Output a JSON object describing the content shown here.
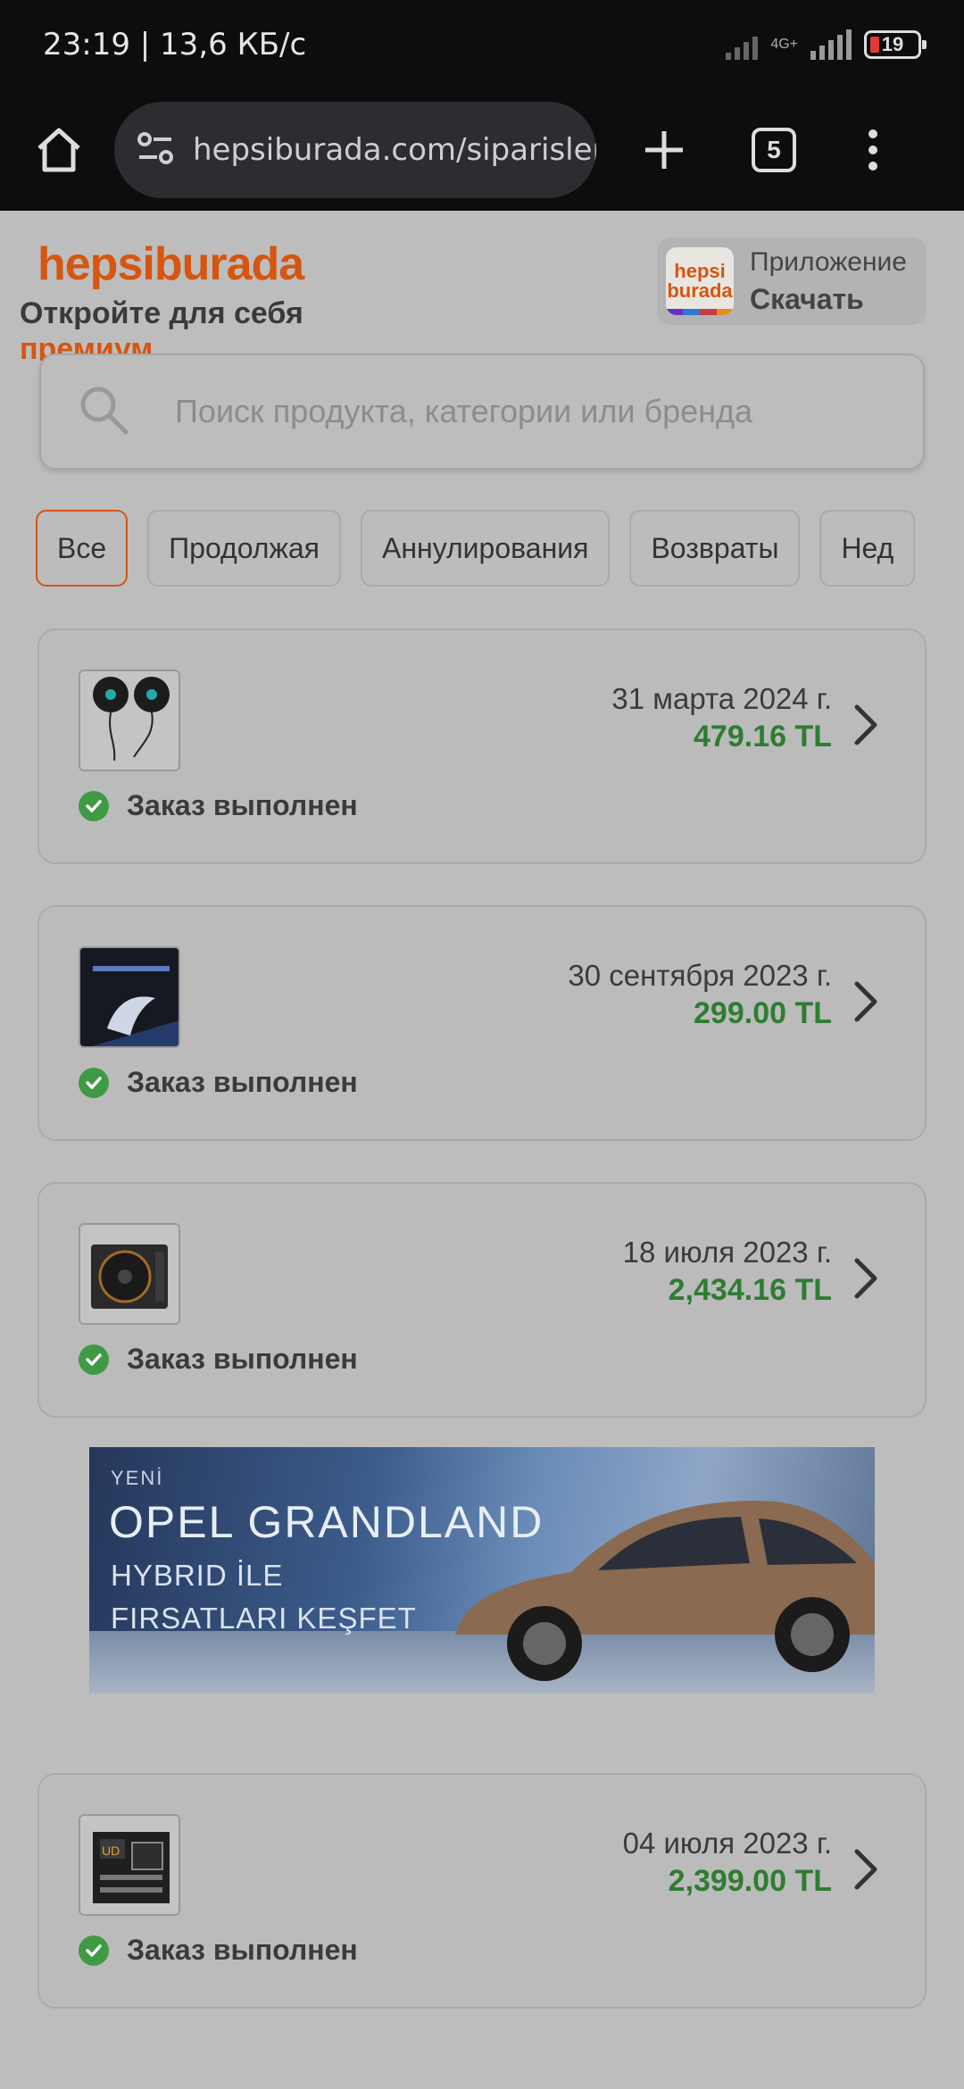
{
  "status_bar": {
    "time_speed": "23:19 | 13,6 КБ/с",
    "network": "4G+",
    "battery": "19"
  },
  "browser": {
    "url": "hepsiburada.com/siparisler",
    "tab_count": "5"
  },
  "header": {
    "brand": "hepsiburada",
    "tagline": "Откройте для себя",
    "tagline_highlight": "премиум",
    "app_icon_line1": "hepsi",
    "app_icon_line2": "burada",
    "app_title": "Приложение",
    "app_cta": "Скачать"
  },
  "search": {
    "placeholder": "Поиск продукта, категории или бренда"
  },
  "filters": [
    {
      "label": "Все",
      "active": true
    },
    {
      "label": "Продолжая",
      "active": false
    },
    {
      "label": "Аннулирования",
      "active": false
    },
    {
      "label": "Возвраты",
      "active": false
    },
    {
      "label": "Нед",
      "active": false
    }
  ],
  "orders": [
    {
      "date": "31 марта 2024 г.",
      "price": "479.16 TL",
      "status": "Заказ выполнен",
      "product_icon": "gpu-fans-image"
    },
    {
      "date": "30 сентября 2023 г.",
      "price": "299.00 TL",
      "status": "Заказ выполнен",
      "product_icon": "ssd-box-image"
    },
    {
      "date": "18 июля 2023 г.",
      "price": "2,434.16 TL",
      "status": "Заказ выполнен",
      "product_icon": "power-supply-image"
    },
    {
      "date": "04 июля 2023 г.",
      "price": "2,399.00 TL",
      "status": "Заказ выполнен",
      "product_icon": "motherboard-image"
    }
  ],
  "banner": {
    "line1": "YENİ",
    "title": "OPEL GRANDLAND",
    "line2": "HYBRID İLE",
    "line3": "FIRSATLARI KEŞFET"
  },
  "colors": {
    "brand_orange": "#d6560f",
    "price_green": "#2e7d32",
    "check_green": "#3f9a44"
  }
}
